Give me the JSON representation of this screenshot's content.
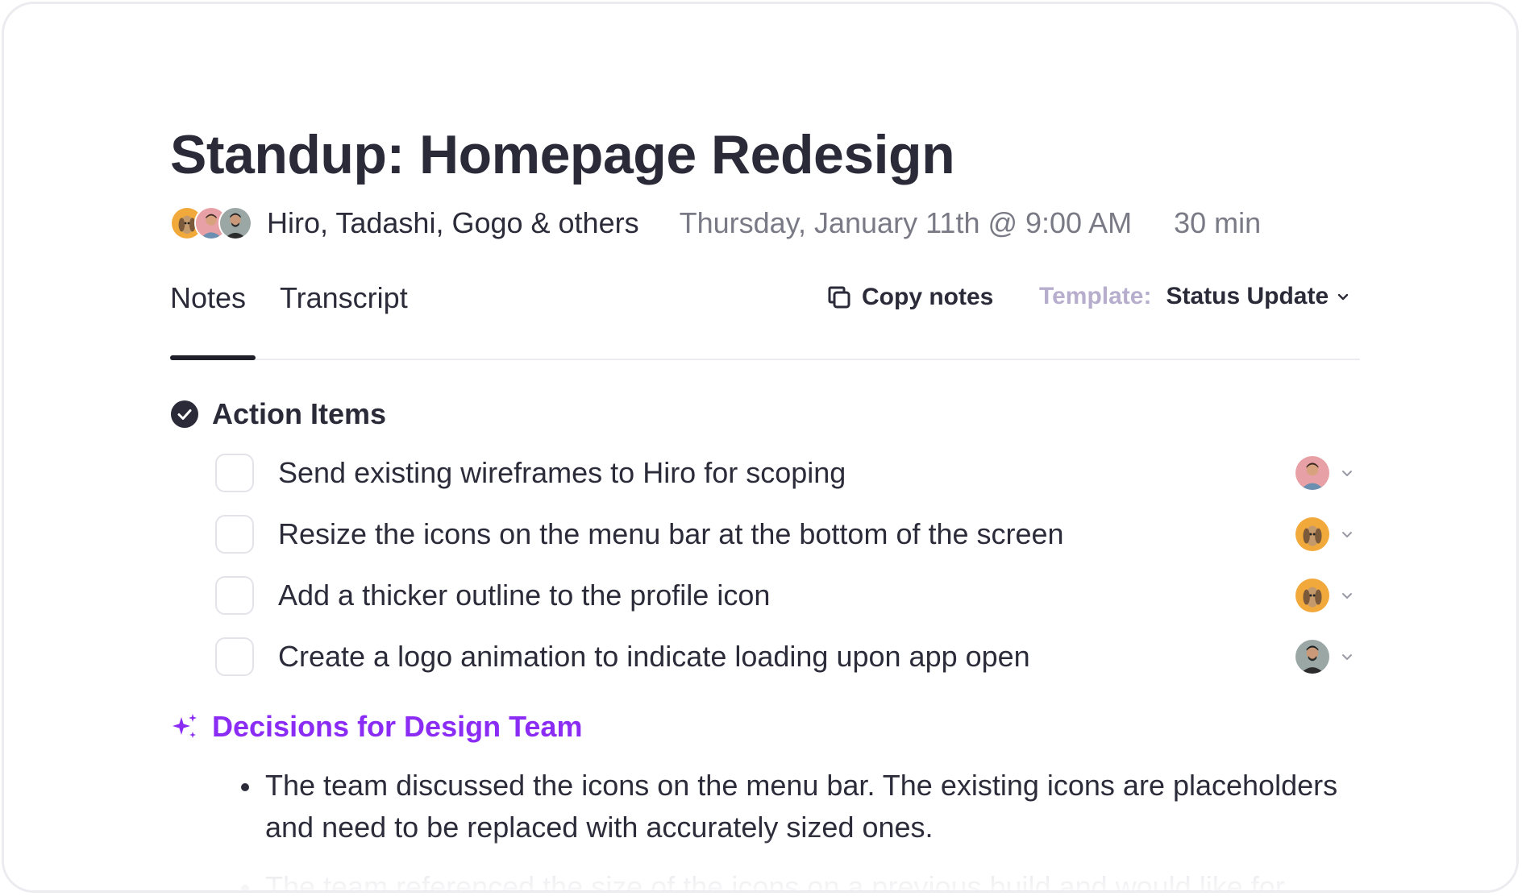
{
  "meeting": {
    "title": "Standup: Homepage Redesign",
    "attendees_text": "Hiro, Tadashi, Gogo & others",
    "datetime": "Thursday, January 11th @ 9:00 AM",
    "duration": "30 min"
  },
  "tabs": [
    {
      "label": "Notes",
      "active": true
    },
    {
      "label": "Transcript",
      "active": false
    }
  ],
  "toolbar": {
    "copy_label": "Copy notes",
    "template_label": "Template:",
    "template_value": "Status Update"
  },
  "action_items": {
    "heading": "Action Items",
    "items": [
      {
        "text": "Send existing wireframes to Hiro for scoping",
        "checked": false
      },
      {
        "text": "Resize the icons on the menu bar at the bottom of the screen",
        "checked": false
      },
      {
        "text": "Add a thicker outline to the profile icon",
        "checked": false
      },
      {
        "text": "Create a logo animation to indicate loading upon app open",
        "checked": false
      }
    ]
  },
  "decisions": {
    "heading": "Decisions for Design Team",
    "bullets": [
      "The team discussed the icons on the menu bar. The existing icons are placeholders and need to be replaced with accurately sized ones.",
      "The team referenced the size of the icons on a previous build and would like for"
    ]
  },
  "colors": {
    "accent_purple": "#8b2cf5",
    "text_dark": "#2a2a38",
    "text_muted": "#7a7a86",
    "template_label": "#b7aecd",
    "avatar_orange": "#f2a93b",
    "avatar_pink": "#e7a0a6",
    "avatar_gray": "#9aa7a4"
  },
  "icons": {
    "action_items": "check-circle-icon",
    "decisions": "sparkle-icon",
    "copy": "copy-icon",
    "dropdown": "chevron-down-icon"
  }
}
